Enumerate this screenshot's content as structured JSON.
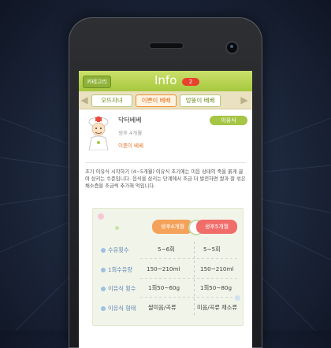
{
  "header": {
    "category_label": "카테고리",
    "title": "Info",
    "badge": "2"
  },
  "tabs": [
    {
      "label": "오뜨자녀",
      "active": false
    },
    {
      "label": "이쁜이 베베",
      "active": true
    },
    {
      "label": "엉뚱이 베베",
      "active": false
    }
  ],
  "profile": {
    "name": "닥터베베",
    "subtitle": "생후 4개월",
    "tag": "이쁜이 베베",
    "category_pill": "이유식"
  },
  "article": {
    "body": "초기 이유식 시작하기 (4~5개월) 이유식 초기에는 미음 상태의 죽을 묽게 끓여 삼키는 수준입니다. 음식을 삼키는 단계에서 조금 더 발전하면 쌀과 잘 섞은 채소즙을 조금씩 추가해 먹입니다."
  },
  "table": {
    "col_a": "생후4개월",
    "col_b": "생후5개월",
    "rows": [
      {
        "label": "수유횟수",
        "a": "5~6회",
        "b": "5~5회"
      },
      {
        "label": "1회수유량",
        "a": "150~210ml",
        "b": "150~210ml"
      },
      {
        "label": "이유식 횟수",
        "a": "1회50~60g",
        "b": "1회50~80g"
      },
      {
        "label": "이유식 형태",
        "a": "쌀미음/곡류",
        "b": "미음/곡류 채소류"
      }
    ]
  },
  "colors": {
    "topbar": "#a7c83f",
    "accent_orange": "#f08a26",
    "badge_red": "#e8412e",
    "header_a": "#f4a15a",
    "header_b": "#f06d6a"
  },
  "icons": [
    "chevron-left-icon",
    "chevron-right-icon",
    "doctor-avatar-icon",
    "baby-face-icon",
    "camera-icon",
    "speaker-icon"
  ]
}
